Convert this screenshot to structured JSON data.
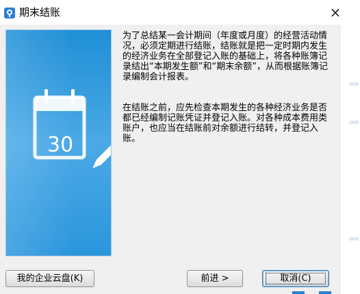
{
  "window": {
    "title": "期末结账",
    "close_symbol": "×",
    "app_icon": "app-logo-icon"
  },
  "banner": {
    "calendar_day": "30",
    "icon": "calendar-edit-icon",
    "colors": {
      "gradient_top": "#1f8fd6",
      "gradient_bottom": "#2a96dc"
    }
  },
  "description": {
    "paragraphs": [
      "为了总结某一会计期间（年度或月度）的经营活动情况，必须定期进行结账，结账就是把一定时期内发生的经济业务在全部登记入账的基础上，将各种账簿记录结出“本期发生额”和“期末余额”，从而根据账簿记录编制会计报表。",
      "在结账之前，应先检查本期发生的各种经济业务是否都已经编制记账凭证并登记入账。对各种成本费用类账户，也应当在结账前对余额进行结转，并登记入账。"
    ]
  },
  "buttons": {
    "cloud": "我的企业云盘(K)",
    "next": "前进 >",
    "cancel": "取消(C)"
  },
  "colors": {
    "accent": "#2b7fd1",
    "dialog_bg": "#f0f0f0"
  }
}
